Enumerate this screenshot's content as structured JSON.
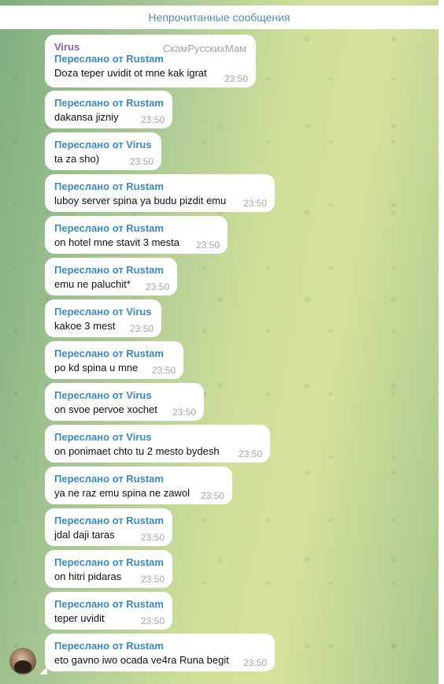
{
  "unread_banner": "Непрочитанные сообщения",
  "first_message": {
    "sender": "Virus",
    "channel": "СкамРусскихМам",
    "forwarded": "Переслано от Rustam",
    "text": "Doza teper uvidit ot mne kak igrat",
    "time": "23:50"
  },
  "messages": [
    {
      "forwarded": "Переслано от Rustam",
      "text": "dakansa jizniy",
      "time": "23:50"
    },
    {
      "forwarded": "Переслано от Virus",
      "text": "ta za sho)",
      "time": "23:50"
    },
    {
      "forwarded": "Переслано от Rustam",
      "text": "luboy server spina ya budu pizdit emu",
      "time": "23:50"
    },
    {
      "forwarded": "Переслано от Rustam",
      "text": "on hotel mne stavit 3 mesta",
      "time": "23:50"
    },
    {
      "forwarded": "Переслано от Rustam",
      "text": "emu ne paluchit*",
      "time": "23:50"
    },
    {
      "forwarded": "Переслано от Virus",
      "text": "kakoe 3 mest",
      "time": "23:50"
    },
    {
      "forwarded": "Переслано от Rustam",
      "text": "po kd spina u mne",
      "time": "23:50"
    },
    {
      "forwarded": "Переслано от Virus",
      "text": "on svoe pervoe xochet",
      "time": "23:50"
    },
    {
      "forwarded": "Переслано от Virus",
      "text": "on ponimaet chto tu 2 mesto bydesh",
      "time": "23:50"
    },
    {
      "forwarded": "Переслано от Rustam",
      "text": "ya ne raz emu spina ne zawol",
      "time": "23:50"
    },
    {
      "forwarded": "Переслано от Rustam",
      "text": "jdal daji taras",
      "time": "23:50"
    },
    {
      "forwarded": "Переслано от Rustam",
      "text": "on hitri pidaras",
      "time": "23:50"
    },
    {
      "forwarded": "Переслано от Rustam",
      "text": "teper uvidit",
      "time": "23:50"
    },
    {
      "forwarded": "Переслано от Rustam",
      "text": "eto gavno iwo ocada ve4ra Runa begit",
      "time": "23:50"
    }
  ]
}
